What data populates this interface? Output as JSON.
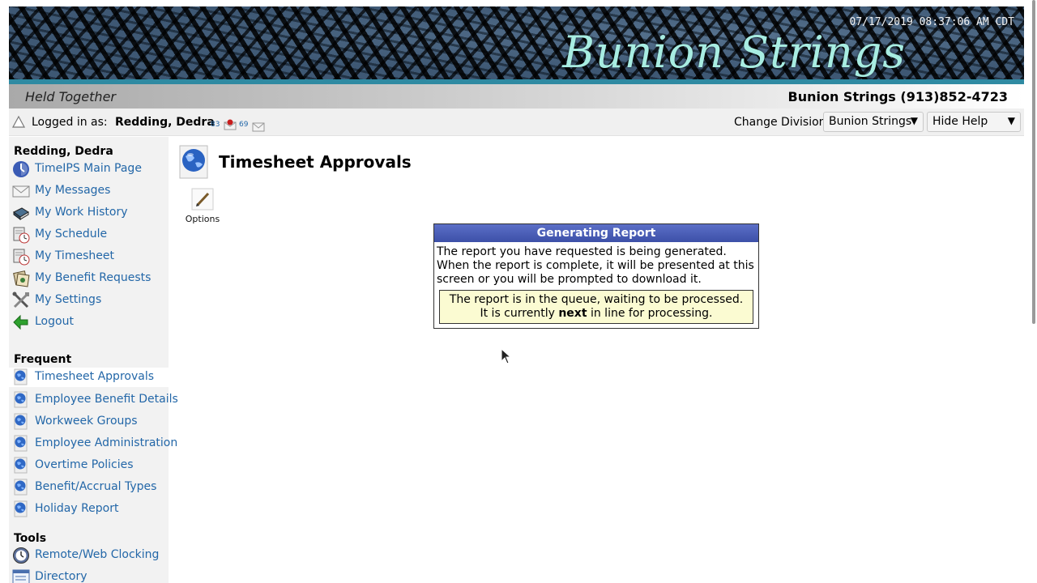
{
  "banner": {
    "timestamp": "07/17/2019 08:37:06 AM CDT",
    "brand_script": "Bunion Strings",
    "tagline": "Held Together",
    "company_phone": "Bunion Strings (913)852-4723"
  },
  "login_bar": {
    "logged_in_label": "Logged in as:",
    "user_name": "Redding, Dedra",
    "messages_count_1": "83",
    "messages_count_2": "69",
    "change_division_label": "Change Division:",
    "division_selected": "Bunion Strings",
    "help_selected": "Hide Help"
  },
  "sidebar": {
    "user_heading": "Redding, Dedra",
    "user_items": [
      {
        "label": "TimeIPS Main Page",
        "icon": "clock-icon"
      },
      {
        "label": "My Messages",
        "icon": "envelope-icon"
      },
      {
        "label": "My Work History",
        "icon": "book-icon"
      },
      {
        "label": "My Schedule",
        "icon": "calendar-clock-icon"
      },
      {
        "label": "My Timesheet",
        "icon": "timesheet-icon"
      },
      {
        "label": "My Benefit Requests",
        "icon": "benefit-icon"
      },
      {
        "label": "My Settings",
        "icon": "tools-icon"
      },
      {
        "label": "Logout",
        "icon": "logout-arrow-icon"
      }
    ],
    "frequent_heading": "Frequent",
    "frequent_items": [
      {
        "label": "Timesheet Approvals"
      },
      {
        "label": "Employee Benefit Details"
      },
      {
        "label": "Workweek Groups"
      },
      {
        "label": "Employee Administration"
      },
      {
        "label": "Overtime Policies"
      },
      {
        "label": "Benefit/Accrual Types"
      },
      {
        "label": "Holiday Report"
      }
    ],
    "tools_heading": "Tools",
    "tools_items": [
      {
        "label": "Remote/Web Clocking",
        "icon": "web-clock-icon"
      },
      {
        "label": "Directory",
        "icon": "directory-icon"
      }
    ]
  },
  "main": {
    "page_title": "Timesheet Approvals",
    "options_label": "Options"
  },
  "report": {
    "title": "Generating Report",
    "description": "The report you have requested is being generated. When the report is complete, it will be presented at this screen or you will be prompted to download it.",
    "queue_line1": "The report is in the queue, waiting to be processed.",
    "queue_line2_prefix": "It is currently ",
    "queue_line2_bold": "next",
    "queue_line2_suffix": " in line for processing."
  },
  "colors": {
    "link": "#2367a8",
    "banner_strip": "#2f8aa2",
    "dialog_header": "#4a5db8",
    "queue_bg": "#fbfbd2"
  }
}
